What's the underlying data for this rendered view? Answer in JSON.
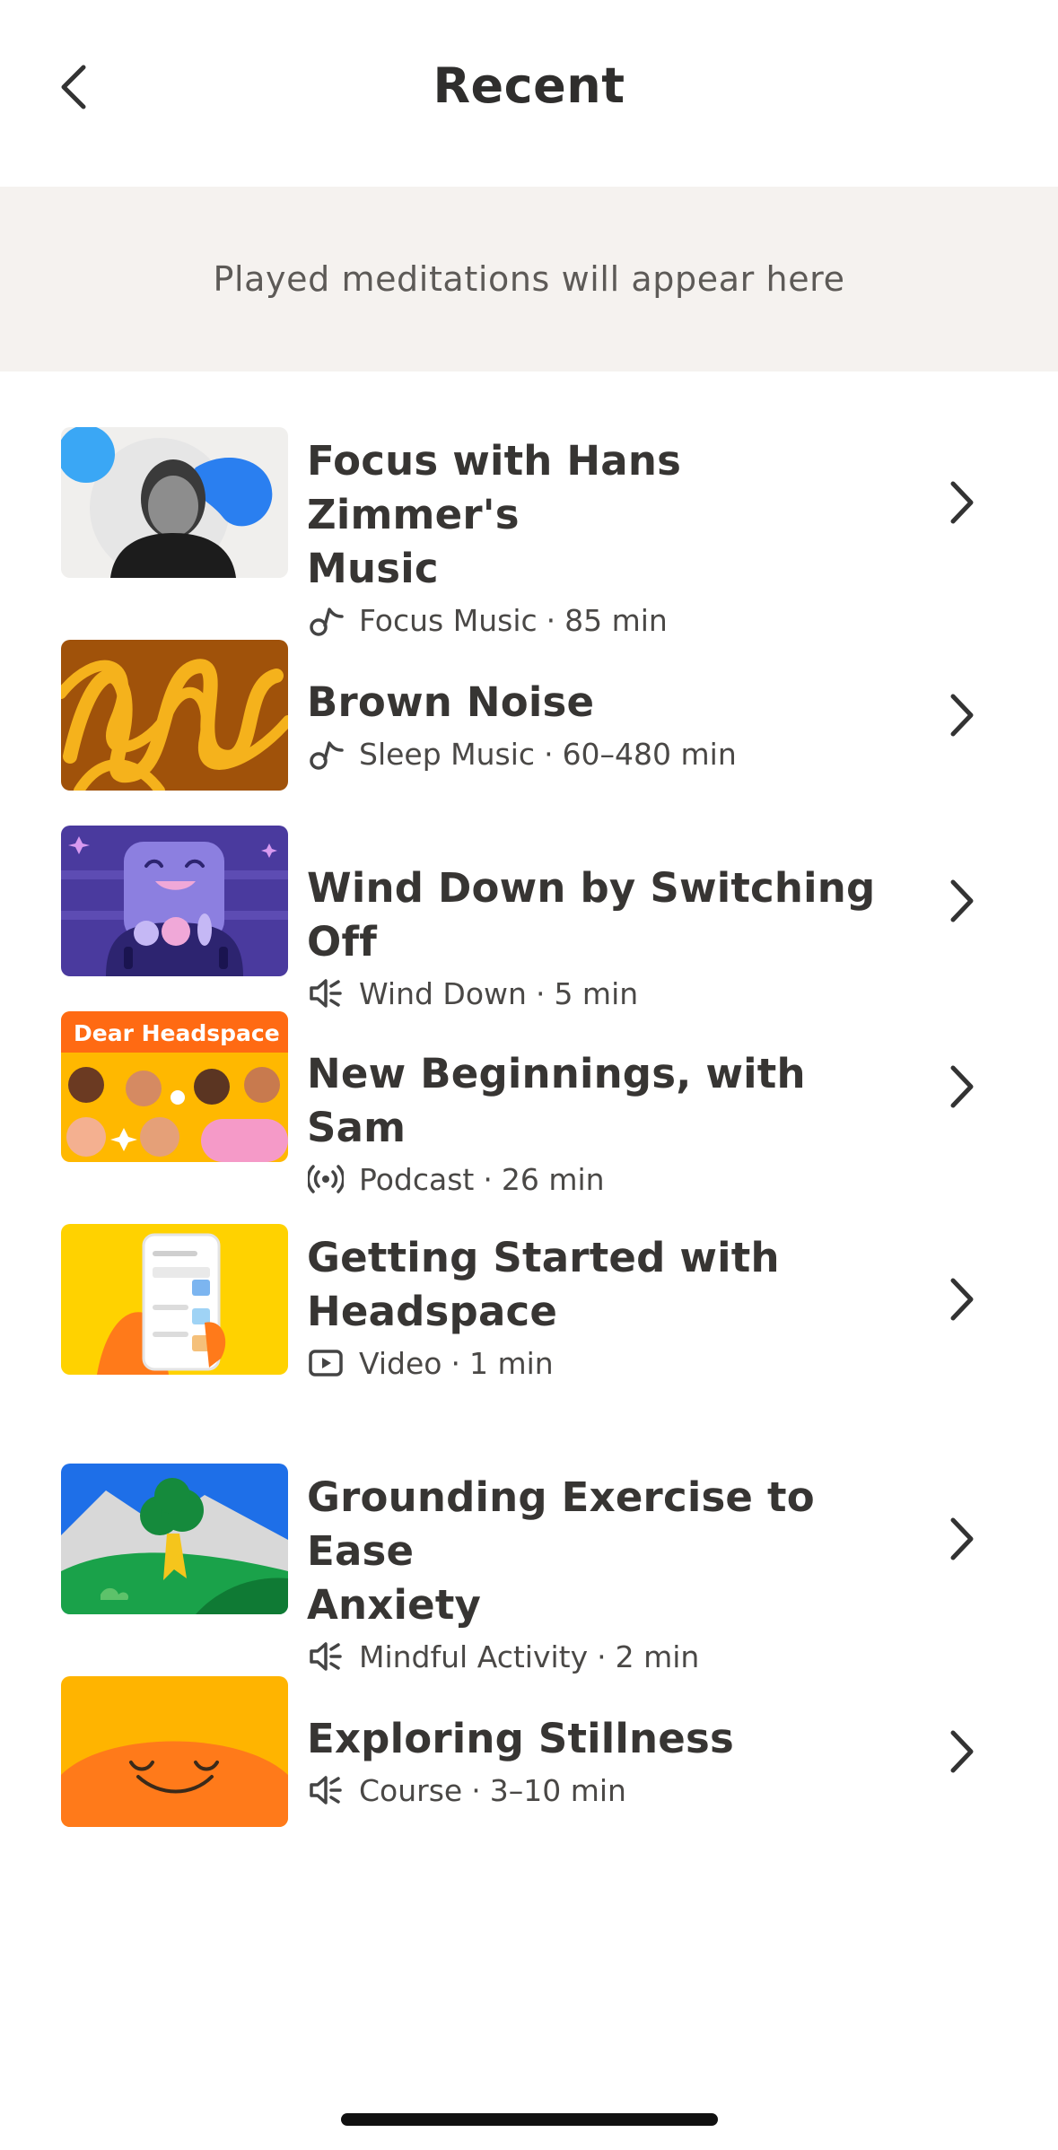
{
  "header": {
    "title": "Recent",
    "back_icon": "chevron-left-icon"
  },
  "banner": {
    "text": "Played meditations will appear here"
  },
  "items": [
    {
      "title_line1": "Focus with Hans Zimmer's",
      "title_line2": "Music",
      "type_icon": "music-note-icon",
      "category": "Focus Music",
      "duration": "85 min"
    },
    {
      "title_line1": "Brown Noise",
      "title_line2": "",
      "type_icon": "music-note-icon",
      "category": "Sleep Music",
      "duration": "60–480 min"
    },
    {
      "title_line1": "Wind Down by Switching Off",
      "title_line2": "",
      "type_icon": "speaker-icon",
      "category": "Wind Down",
      "duration": "5 min"
    },
    {
      "title_line1": "New Beginnings, with Sam",
      "title_line2": "",
      "type_icon": "podcast-icon",
      "category": "Podcast",
      "duration": "26 min",
      "thumb_text": "Dear Headspace"
    },
    {
      "title_line1": "Getting Started with",
      "title_line2": "Headspace",
      "type_icon": "video-icon",
      "category": "Video",
      "duration": "1 min"
    },
    {
      "title_line1": "Grounding Exercise to Ease",
      "title_line2": "Anxiety",
      "type_icon": "speaker-icon",
      "category": "Mindful Activity",
      "duration": "2 min"
    },
    {
      "title_line1": "Exploring Stillness",
      "title_line2": "",
      "type_icon": "speaker-icon",
      "category": "Course",
      "duration": "3–10 min"
    }
  ],
  "separator": "·",
  "colors": {
    "banner_bg": "#f5f2ef",
    "text_primary": "#373533",
    "text_secondary": "#4a4846"
  }
}
